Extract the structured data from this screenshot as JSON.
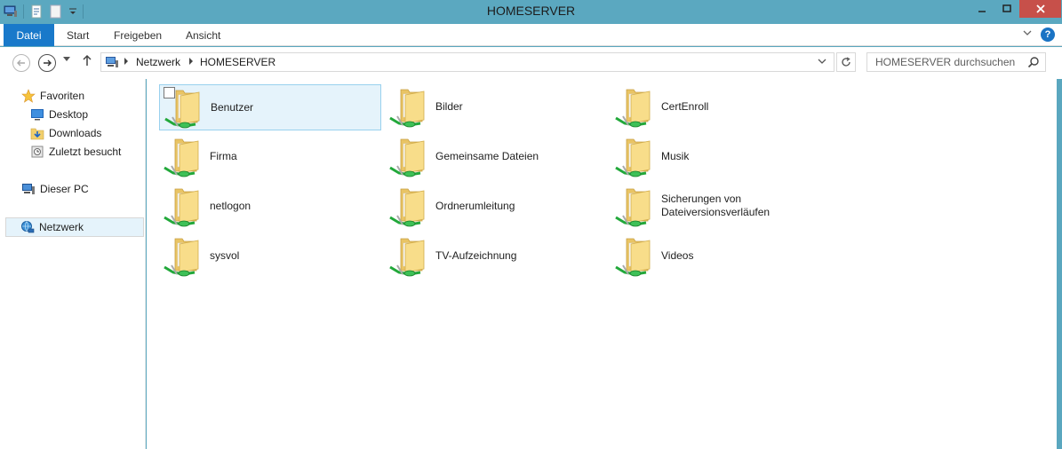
{
  "window": {
    "title": "HOMESERVER"
  },
  "ribbon": {
    "tabs": [
      {
        "label": "Datei",
        "active": true
      },
      {
        "label": "Start"
      },
      {
        "label": "Freigeben"
      },
      {
        "label": "Ansicht"
      }
    ],
    "help": "?"
  },
  "address": {
    "crumbs": [
      "Netzwerk",
      "HOMESERVER"
    ],
    "search_placeholder": "HOMESERVER durchsuchen"
  },
  "nav": {
    "favorites_label": "Favoriten",
    "favorites": [
      "Desktop",
      "Downloads",
      "Zuletzt besucht"
    ],
    "this_pc": "Dieser PC",
    "network": "Netzwerk"
  },
  "items": [
    {
      "label": "Benutzer",
      "icon": "shared-folder-icon",
      "selected": true
    },
    {
      "label": "Bilder",
      "icon": "shared-folder-icon"
    },
    {
      "label": "CertEnroll",
      "icon": "shared-folder-icon"
    },
    {
      "label": "Firma",
      "icon": "shared-folder-icon"
    },
    {
      "label": "Gemeinsame Dateien",
      "icon": "shared-folder-icon"
    },
    {
      "label": "Musik",
      "icon": "shared-folder-icon"
    },
    {
      "label": "netlogon",
      "icon": "shared-folder-icon"
    },
    {
      "label": "Ordnerumleitung",
      "icon": "shared-folder-icon"
    },
    {
      "label": "Sicherungen von Dateiversionsverläufen",
      "label_line1": "Sicherungen von",
      "label_line2": "Dateiversionsverläufen",
      "icon": "shared-folder-icon"
    },
    {
      "label": "sysvol",
      "icon": "shared-folder-icon"
    },
    {
      "label": "TV-Aufzeichnung",
      "icon": "shared-folder-icon"
    },
    {
      "label": "Videos",
      "icon": "shared-folder-icon"
    }
  ],
  "colors": {
    "titlebar": "#5ba8c0",
    "file_tab": "#1979ca",
    "close_button": "#c7504a",
    "selection": "#e5f3fb"
  }
}
